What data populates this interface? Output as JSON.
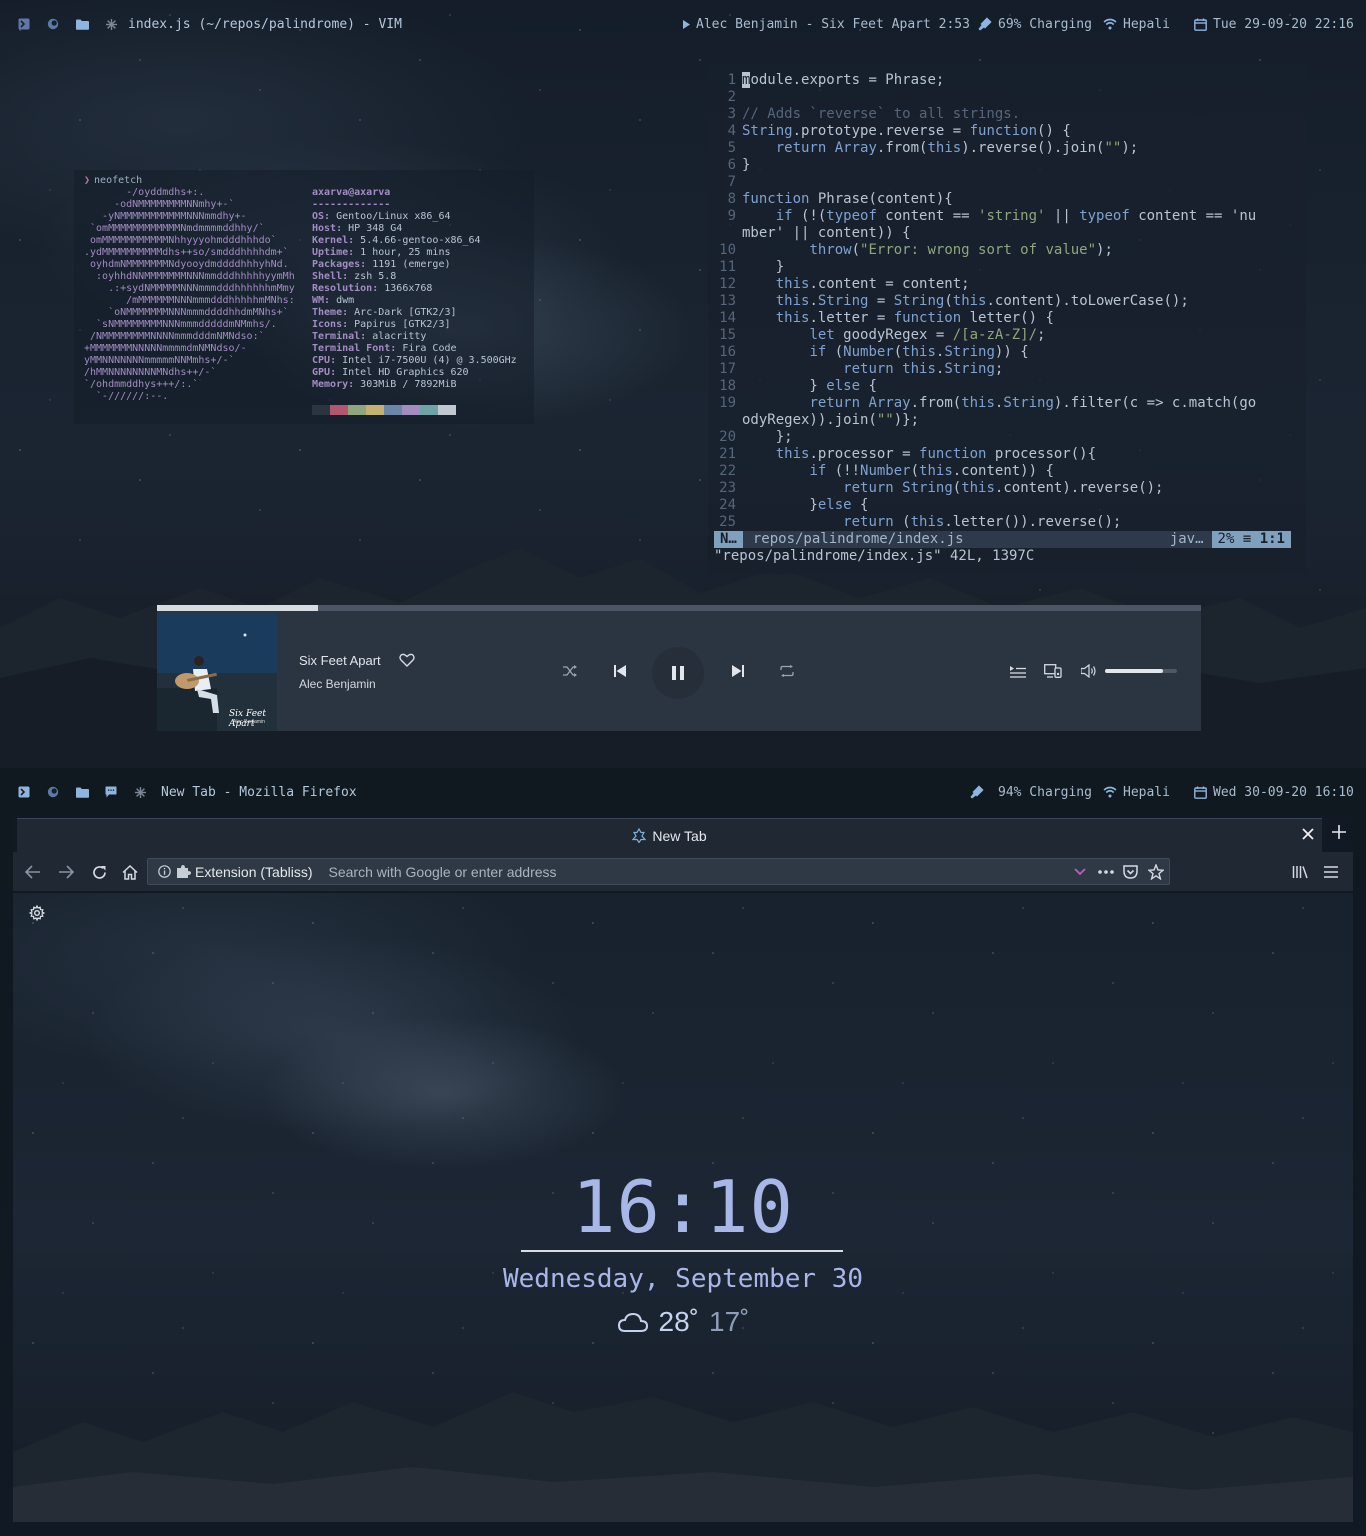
{
  "top_screen": {
    "statusbar": {
      "window_title": "index.js (~/repos/palindrome) - VIM",
      "now_playing": "Alec Benjamin - Six Feet Apart 2:53",
      "battery": "69% Charging",
      "wifi": "Hepali",
      "datetime": "Tue 29-09-20 22:16"
    },
    "neofetch": {
      "prompt": "neofetch",
      "logo_lines": [
        "       -/oyddmdhs+:.",
        "     -odNMMMMMMMMNNmhy+-`",
        "   -yNMMMMMMMMMMMNNNmmdhy+-",
        " `omMMMMMMMMMMMMNmdmmmmddhhy/`",
        " omMMMMMMMMMMMNhhyyyohmdddhhhdo`",
        ".ydMMMMMMMMMMdhs++so/smdddhhhhdm+`",
        " oyhdmNMMMMMMMNdyooydmddddhhhyhNd.",
        "  :oyhhdNNMMMMMMMNNNmmdddhhhhhyymMh",
        "    .:+sydNMMMMMNNNmmmdddhhhhhhmMmy",
        "       /mMMMMMMNNNmmmdddhhhhhmMNhs:",
        "    `oNMMMMMMMNNNmmmddddhhdmMNhs+`",
        "  `sNMMMMMMMMNNNmmmdddddmNMmhs/.",
        " /NMMMMMMMMNNNNmmmdddmNMNdso:`",
        "+MMMMMMMNNNNNmmmmdmNMNdso/-",
        "yMMNNNNNNNmmmmmNNMmhs+/-`",
        "/hMMNNNNNNNNMNdhs++/-`",
        "`/ohdmmddhys+++/:.`",
        "  `-//////:--."
      ],
      "user_host": "axarva@axarva",
      "separator": "-------------",
      "info": [
        {
          "key": "OS",
          "value": "Gentoo/Linux x86_64"
        },
        {
          "key": "Host",
          "value": "HP 348 G4"
        },
        {
          "key": "Kernel",
          "value": "5.4.66-gentoo-x86_64"
        },
        {
          "key": "Uptime",
          "value": "1 hour, 25 mins"
        },
        {
          "key": "Packages",
          "value": "1191 (emerge)"
        },
        {
          "key": "Shell",
          "value": "zsh 5.8"
        },
        {
          "key": "Resolution",
          "value": "1366x768"
        },
        {
          "key": "WM",
          "value": "dwm"
        },
        {
          "key": "Theme",
          "value": "Arc-Dark [GTK2/3]"
        },
        {
          "key": "Icons",
          "value": "Papirus [GTK2/3]"
        },
        {
          "key": "Terminal",
          "value": "alacritty"
        },
        {
          "key": "Terminal Font",
          "value": "Fira Code"
        },
        {
          "key": "CPU",
          "value": "Intel i7-7500U (4) @ 3.500GHz"
        },
        {
          "key": "GPU",
          "value": "Intel HD Graphics 620"
        },
        {
          "key": "Memory",
          "value": "303MiB / 7892MiB"
        }
      ],
      "palette": [
        "#2b3441",
        "#b5566f",
        "#8fa67d",
        "#c6b071",
        "#6b87a8",
        "#a38cc2",
        "#6fa3a8",
        "#c2c8d0"
      ]
    },
    "vim": {
      "lines": [
        {
          "n": "1",
          "text": "module.exports = Phrase;"
        },
        {
          "n": "2",
          "text": ""
        },
        {
          "n": "3",
          "text": "// Adds `reverse` to all strings."
        },
        {
          "n": "4",
          "text": "String.prototype.reverse = function() {"
        },
        {
          "n": "5",
          "text": "    return Array.from(this).reverse().join(\"\");"
        },
        {
          "n": "6",
          "text": "}"
        },
        {
          "n": "7",
          "text": ""
        },
        {
          "n": "8",
          "text": "function Phrase(content){"
        },
        {
          "n": "9",
          "text": "    if (!(typeof content == 'string' || typeof content == 'nu"
        },
        {
          "n": "",
          "text": "mber' || content)) {"
        },
        {
          "n": "10",
          "text": "        throw(\"Error: wrong sort of value\");"
        },
        {
          "n": "11",
          "text": "    }"
        },
        {
          "n": "12",
          "text": "    this.content = content;"
        },
        {
          "n": "13",
          "text": "    this.String = String(this.content).toLowerCase();"
        },
        {
          "n": "14",
          "text": "    this.letter = function letter() {"
        },
        {
          "n": "15",
          "text": "        let goodyRegex = /[a-zA-Z]/;"
        },
        {
          "n": "16",
          "text": "        if (Number(this.String)) {"
        },
        {
          "n": "17",
          "text": "            return this.String;"
        },
        {
          "n": "18",
          "text": "        } else {"
        },
        {
          "n": "19",
          "text": "        return Array.from(this.String).filter(c => c.match(go"
        },
        {
          "n": "",
          "text": "odyRegex)).join(\"\")};"
        },
        {
          "n": "20",
          "text": "    };"
        },
        {
          "n": "21",
          "text": "    this.processor = function processor(){"
        },
        {
          "n": "22",
          "text": "        if (!!Number(this.content)) {"
        },
        {
          "n": "23",
          "text": "            return String(this.content).reverse();"
        },
        {
          "n": "24",
          "text": "        }else {"
        },
        {
          "n": "25",
          "text": "            return (this.letter()).reverse();"
        }
      ],
      "status_mode": "N…",
      "status_file": "repos/palindrome/index.js",
      "status_filetype": "jav…",
      "status_percent": "2% ≡",
      "status_position": "1:1",
      "message": "\"repos/palindrome/index.js\" 42L, 1397C"
    },
    "player": {
      "track": "Six Feet Apart",
      "artist": "Alec Benjamin",
      "album_title": "Six Feet Apart",
      "album_artist": "Alec Benjamin",
      "progress_fraction": 0.154,
      "volume_fraction": 0.8
    }
  },
  "bottom_screen": {
    "statusbar": {
      "window_title": "New Tab - Mozilla Firefox",
      "battery": "94% Charging",
      "wifi": "Hepali",
      "datetime": "Wed 30-09-20 16:10"
    },
    "firefox": {
      "tab_title": "New Tab",
      "url_identity": "Extension (Tabliss)",
      "url_placeholder": "Search with Google or enter address",
      "clock": "16:10",
      "date": "Wednesday, September 30",
      "weather_high": "28˚",
      "weather_low": "17˚"
    }
  }
}
